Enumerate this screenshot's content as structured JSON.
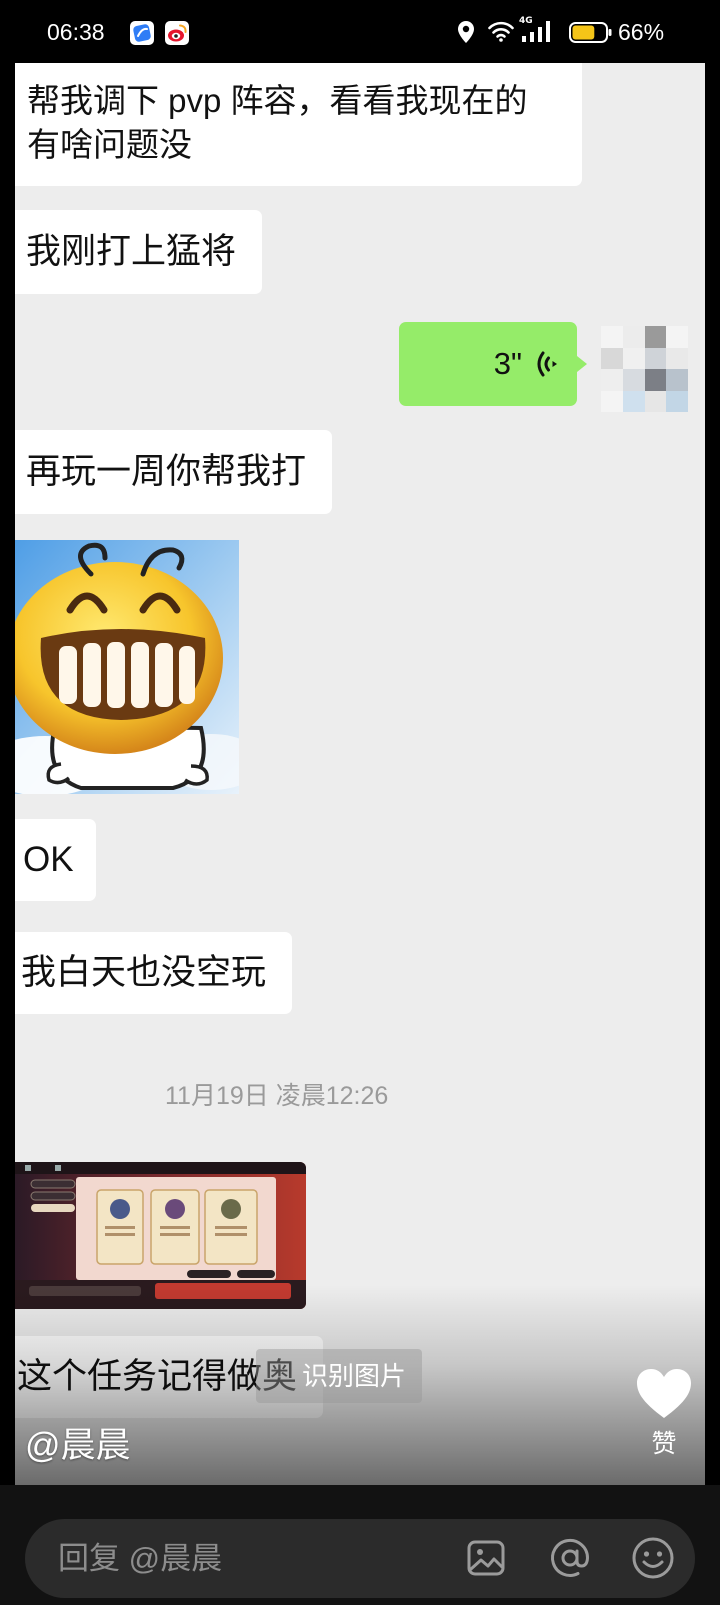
{
  "status_bar": {
    "time": "06:38",
    "cellular_label": "4G",
    "battery_text": "66%",
    "battery_level": 0.66,
    "battery_color": "#f5c518",
    "icons": {
      "app1": "browser-app-icon",
      "app2": "weibo-icon",
      "location": "location-icon",
      "wifi": "wifi-icon",
      "signal": "cellular-signal-icon",
      "battery": "battery-icon"
    }
  },
  "chat_screenshot": {
    "background_color": "#ededed",
    "incoming_bubble_color": "#ffffff",
    "outgoing_bubble_color": "#95ec69",
    "messages": [
      {
        "lines": [
          "帮我调下 pvp 阵容，看看我现在的",
          "有啥问题没"
        ]
      },
      {
        "lines": [
          "我刚打上猛将"
        ]
      },
      {
        "voice_duration": "3\"",
        "icon": "voice-wave-icon",
        "avatar_icon": "pixelated-avatar"
      },
      {
        "lines": [
          "再玩一周你帮我打"
        ]
      },
      {
        "icon": "grinning-face-sticker"
      },
      {
        "lines": [
          "OK"
        ]
      },
      {
        "lines": [
          "我白天也没空玩"
        ]
      },
      {
        "timestamp": "11月19日 凌晨12:26"
      },
      {
        "icon": "game-screenshot-thumbnail"
      },
      {
        "lines": [
          "这个任务记得做奥"
        ]
      }
    ]
  },
  "overlay": {
    "recognize_image_label": "识别图片",
    "author_handle": "@晨晨",
    "like_label": "赞",
    "like_icon": "heart-icon"
  },
  "reply_bar": {
    "placeholder": "回复 @晨晨",
    "icons": [
      "image-icon",
      "at-icon",
      "emoji-icon"
    ]
  }
}
